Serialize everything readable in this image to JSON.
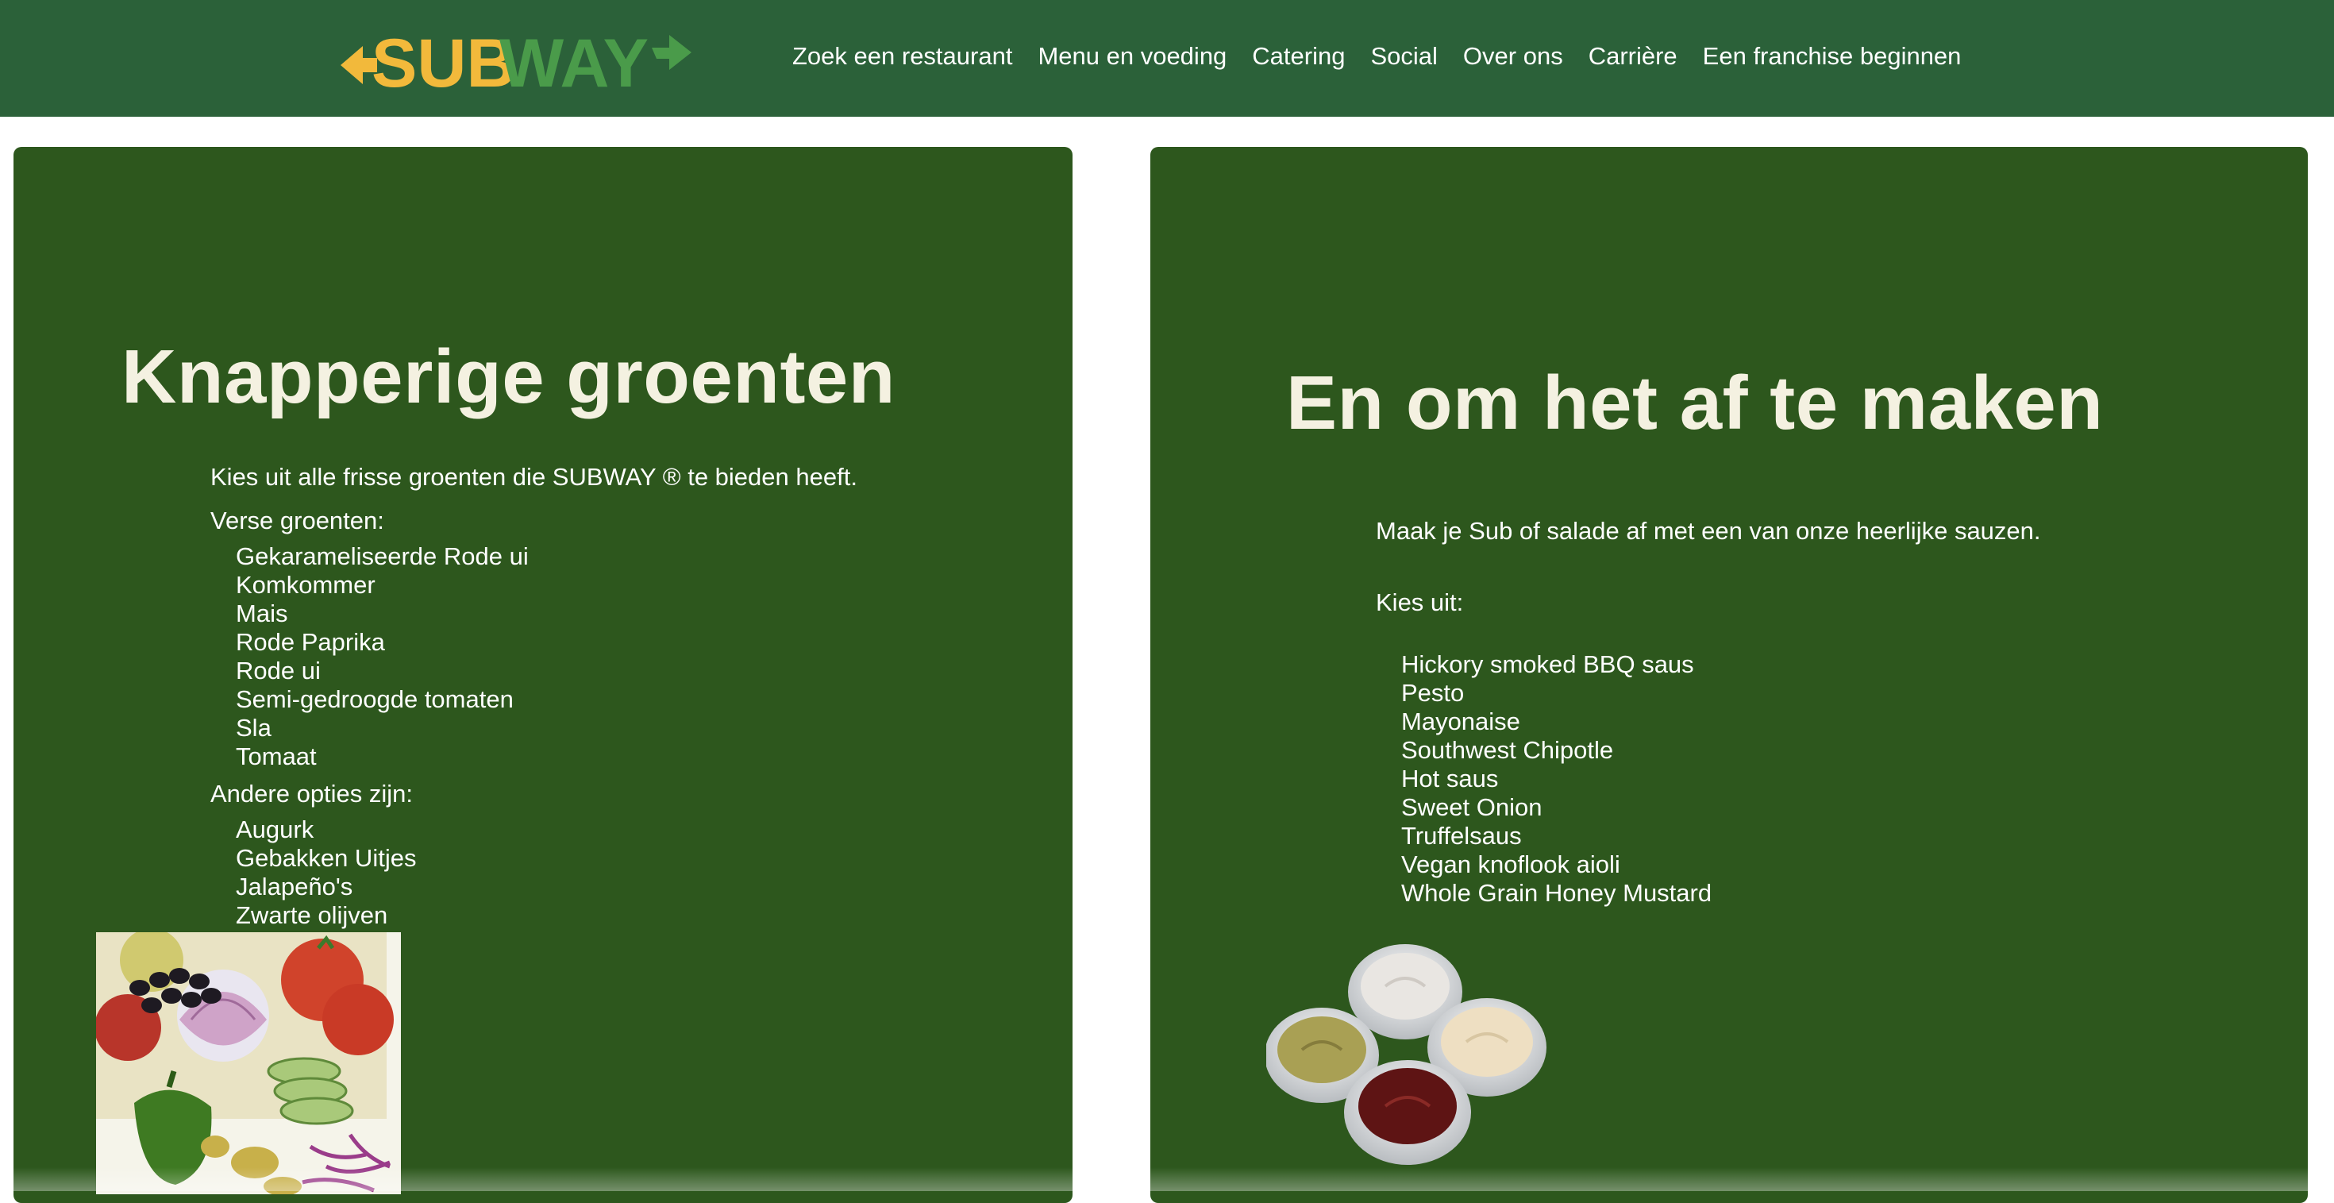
{
  "header": {
    "logo_text_sub": "SUB",
    "logo_text_way": "WAY",
    "nav": [
      {
        "label": "Zoek een restaurant"
      },
      {
        "label": "Menu en voeding"
      },
      {
        "label": "Catering"
      },
      {
        "label": "Social"
      },
      {
        "label": "Over ons"
      },
      {
        "label": "Carrière"
      },
      {
        "label": "Een franchise beginnen"
      }
    ]
  },
  "left": {
    "title": "Knapperige groenten",
    "intro": "Kies uit alle frisse groenten die SUBWAY ® te bieden heeft.",
    "fresh_heading": "Verse groenten:",
    "fresh_items": [
      "Gekarameliseerde Rode ui",
      "Komkommer",
      "Mais",
      "Rode Paprika",
      "Rode ui",
      "Semi-gedroogde tomaten",
      "Sla",
      "Tomaat"
    ],
    "other_heading": "Andere opties zijn:",
    "other_items": [
      "Augurk",
      "Gebakken Uitjes",
      "Jalapeño's",
      "Zwarte olijven"
    ]
  },
  "right": {
    "title": "En om het af te maken",
    "intro": "Maak je Sub of salade af met een van onze heerlijke sauzen.",
    "choose": "Kies uit:",
    "sauces": [
      "Hickory smoked BBQ saus",
      "Pesto",
      "Mayonaise",
      "Southwest Chipotle",
      "Hot saus",
      "Sweet Onion",
      "Truffelsaus",
      "Vegan knoflook aioli",
      "Whole Grain Honey Mustard"
    ]
  },
  "colors": {
    "header_bg": "#2b6139",
    "panel_bg": "#2d571d",
    "logo_yellow": "#f2b93b",
    "logo_green": "#4a9b4a",
    "title_color": "#f4f1e1"
  },
  "icons": {
    "vegetables_image": "vegetables-photo",
    "sauces_image": "sauce-cups-photo"
  }
}
